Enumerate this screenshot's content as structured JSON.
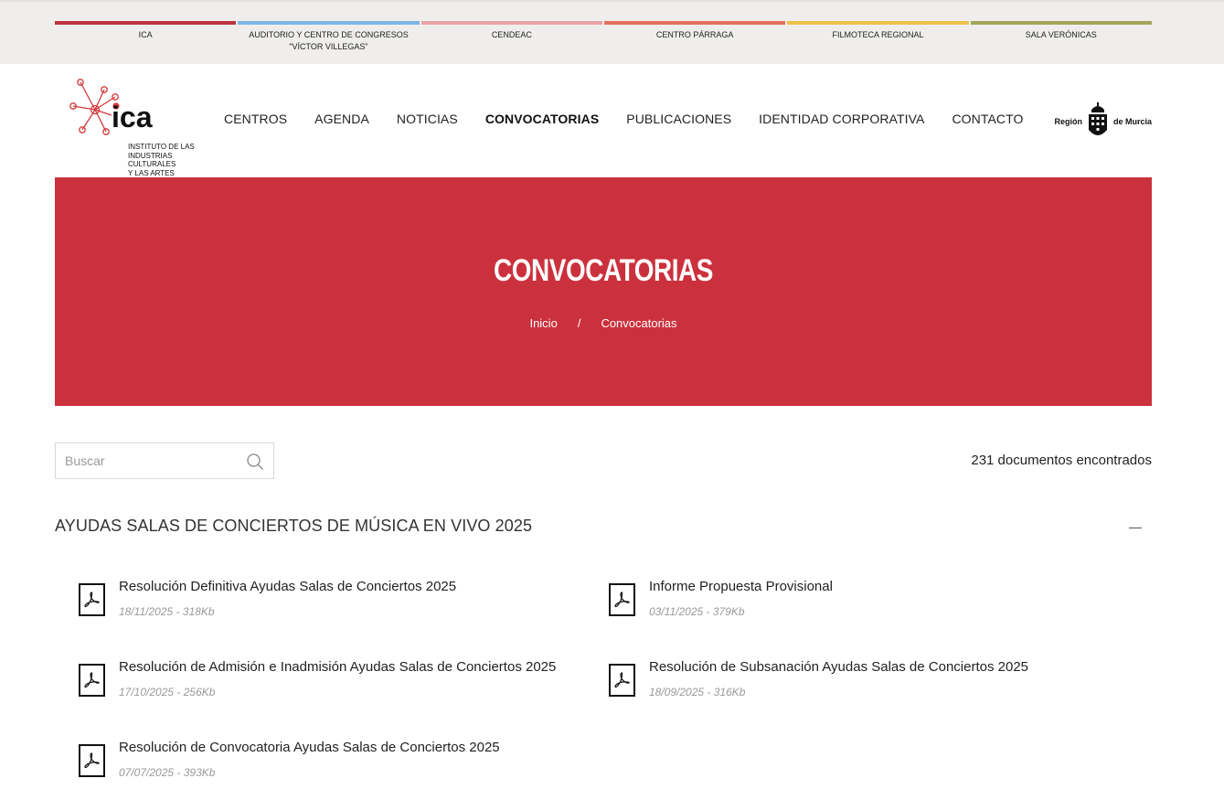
{
  "centers": [
    {
      "label": "ICA",
      "color": "#b9343f"
    },
    {
      "label": "AUDITORIO Y CENTRO DE CONGRESOS\n\"VÍCTOR VILLEGAS\"",
      "color": "#7cb7e3"
    },
    {
      "label": "CENDEAC",
      "color": "#e9a4a6"
    },
    {
      "label": "CENTRO PÁRRAGA",
      "color": "#e4705e"
    },
    {
      "label": "FILMOTECA REGIONAL",
      "color": "#edc34c"
    },
    {
      "label": "SALA VERÓNICAS",
      "color": "#a3a55b"
    }
  ],
  "logo": {
    "name": "ica",
    "subtitle": "INSTITUTO DE LAS\nINDUSTRIAS CULTURALES\nY LAS ARTES"
  },
  "nav": [
    {
      "label": "CENTROS",
      "active": false
    },
    {
      "label": "AGENDA",
      "active": false
    },
    {
      "label": "NOTICIAS",
      "active": false
    },
    {
      "label": "CONVOCATORIAS",
      "active": true
    },
    {
      "label": "PUBLICACIONES",
      "active": false
    },
    {
      "label": "IDENTIDAD CORPORATIVA",
      "active": false
    },
    {
      "label": "CONTACTO",
      "active": false
    }
  ],
  "region": {
    "left": "Región",
    "right": "de Murcia"
  },
  "hero": {
    "title": "CONVOCATORIAS",
    "breadcrumb": {
      "home": "Inicio",
      "separator": "/",
      "current": "Convocatorias"
    },
    "color": "#cb313d"
  },
  "search": {
    "placeholder": "Buscar",
    "value": ""
  },
  "results_count": "231 documentos encontrados",
  "group": {
    "title": "AYUDAS SALAS DE CONCIERTOS DE MÚSICA EN VIVO 2025",
    "documents": [
      {
        "title": "Resolución Definitiva Ayudas Salas de Conciertos 2025",
        "meta": "18/11/2025 - 318Kb"
      },
      {
        "title": "Informe Propuesta Provisional",
        "meta": "03/11/2025 - 379Kb"
      },
      {
        "title": "Resolución de Admisión e Inadmisión Ayudas Salas de Conciertos 2025",
        "meta": "17/10/2025 - 256Kb"
      },
      {
        "title": "Resolución de Subsanación Ayudas Salas de Conciertos 2025",
        "meta": "18/09/2025 - 316Kb"
      },
      {
        "title": "Resolución de Convocatoria Ayudas Salas de Conciertos 2025",
        "meta": "07/07/2025 - 393Kb"
      }
    ]
  }
}
